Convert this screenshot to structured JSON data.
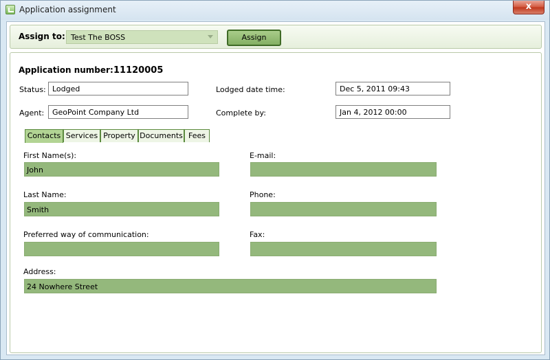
{
  "window": {
    "title": "Application assignment",
    "close_glyph": "x"
  },
  "assign": {
    "label": "Assign to:",
    "selected": "Test The BOSS",
    "button": "Assign"
  },
  "application": {
    "number_label": "Application number:",
    "number": "11120005",
    "status_label": "Status:",
    "status": "Lodged",
    "lodged_label": "Lodged date time:",
    "lodged": "Dec 5, 2011 09:43",
    "agent_label": "Agent:",
    "agent": "GeoPoint Company Ltd",
    "complete_label": "Complete by:",
    "complete": "Jan 4, 2012 00:00"
  },
  "tabs": [
    "Contacts",
    "Services",
    "Property",
    "Documents",
    "Fees"
  ],
  "contact": {
    "first_name_label": "First Name(s):",
    "first_name": "John",
    "email_label": "E-mail:",
    "email": "",
    "last_name_label": "Last Name:",
    "last_name": "Smith",
    "phone_label": "Phone:",
    "phone": "",
    "preferred_label": "Preferred way of communication:",
    "preferred": "",
    "fax_label": "Fax:",
    "fax": "",
    "address_label": "Address:",
    "address": "24 Nowhere Street"
  },
  "colors": {
    "accent_green": "#94b87c",
    "active_tab": "#b2d494",
    "close_red": "#c0351a"
  },
  "icons": {
    "app": "app-icon",
    "close": "close-icon",
    "dropdown": "chevron-down-icon"
  }
}
